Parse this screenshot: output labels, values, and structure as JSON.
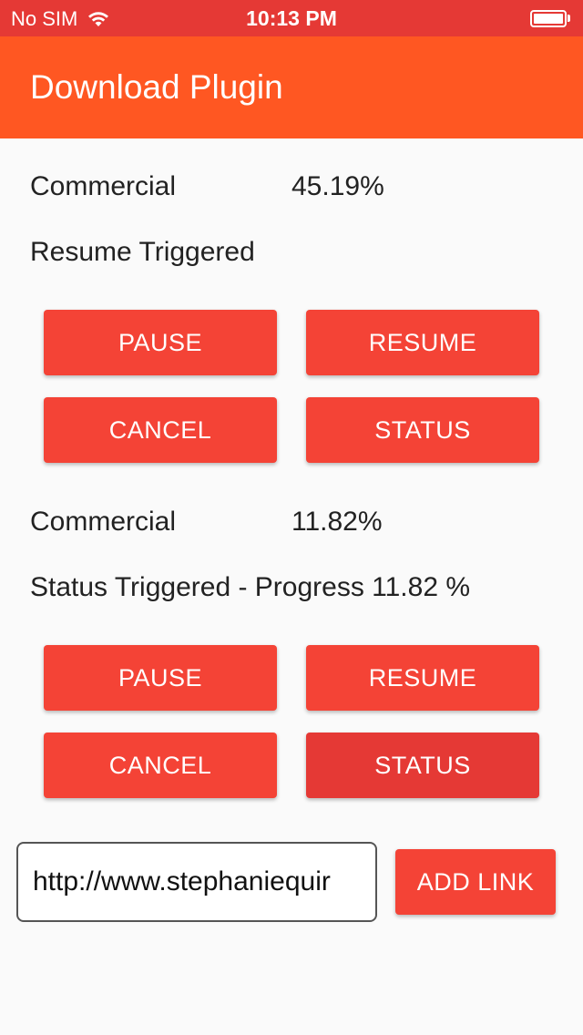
{
  "status_bar": {
    "carrier": "No SIM",
    "time": "10:13 PM",
    "wifi_icon": "wifi-icon",
    "battery_icon": "battery-icon",
    "battery_level": 1.0
  },
  "app_bar": {
    "title": "Download Plugin",
    "color": "#ff5722"
  },
  "downloads": [
    {
      "name": "Commercial",
      "progress": "45.19%",
      "message": "Resume Triggered",
      "buttons": {
        "pause": "PAUSE",
        "resume": "RESUME",
        "cancel": "CANCEL",
        "status": "STATUS"
      }
    },
    {
      "name": "Commercial",
      "progress": "11.82%",
      "message": "Status Triggered - Progress 11.82 %",
      "buttons": {
        "pause": "PAUSE",
        "resume": "RESUME",
        "cancel": "CANCEL",
        "status": "STATUS"
      }
    }
  ],
  "link_input": {
    "value": "http://www.stephaniequir",
    "add_label": "ADD LINK"
  },
  "colors": {
    "status_bar": "#e53935",
    "button": "#f44336",
    "button_pressed": "#e53935",
    "background": "#fafafa"
  }
}
